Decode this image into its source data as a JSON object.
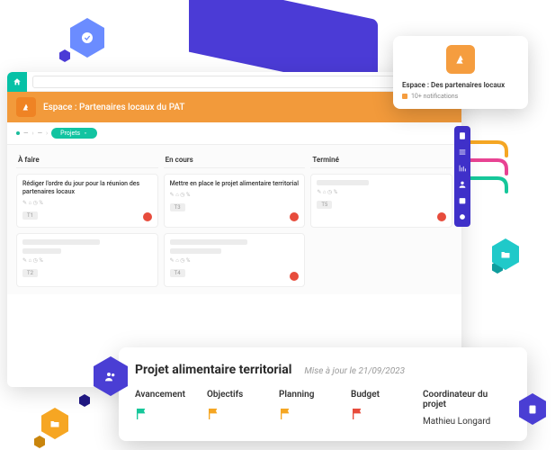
{
  "topbar": {
    "search_placeholder": ""
  },
  "banner": {
    "title": "Espace : Partenaires locaux du PAT"
  },
  "breadcrumb": {
    "pill_label": "Projets"
  },
  "board": {
    "columns": [
      {
        "title": "À faire",
        "cards": [
          {
            "text": "Rédiger l'ordre du jour pour la réunion des partenaires locaux",
            "meta_icons": "✎ ⌂ ◷ %",
            "tag": "T1",
            "alert": true
          },
          {
            "ghost": true,
            "meta_icons": "✎ ⌂ ◷ %",
            "tag": "T2",
            "alert": false
          }
        ]
      },
      {
        "title": "En cours",
        "cards": [
          {
            "text": "Mettre en place le projet alimentaire territorial",
            "meta_icons": "✎ ⌂ ◷ %",
            "tag": "T3",
            "alert": true
          },
          {
            "ghost": true,
            "meta_icons": "✎ ⌂ ◷ %",
            "tag": "T4",
            "alert": true
          }
        ]
      },
      {
        "title": "Terminé",
        "cards": [
          {
            "ghost": true,
            "meta_icons": "✎ ⌂ ◷ %",
            "tag": "T5",
            "alert": true
          }
        ]
      }
    ]
  },
  "notif": {
    "title": "Espace : Des partenaires locaux",
    "sub": "10+ notifications"
  },
  "project": {
    "title": "Projet alimentaire territorial",
    "updated": "Mise à jour le 21/09/2023",
    "cols": [
      {
        "label": "Avancement",
        "flag_color": "#16c79a"
      },
      {
        "label": "Objectifs",
        "flag_color": "#f5a623"
      },
      {
        "label": "Planning",
        "flag_color": "#f5a623"
      },
      {
        "label": "Budget",
        "flag_color": "#e74c3c"
      },
      {
        "label": "Coordinateur du projet",
        "coordinator": "Mathieu Longard"
      }
    ]
  },
  "colors": {
    "accent": "#f29a3b",
    "primary": "#4b3bd6",
    "teal": "#12c4a1"
  }
}
